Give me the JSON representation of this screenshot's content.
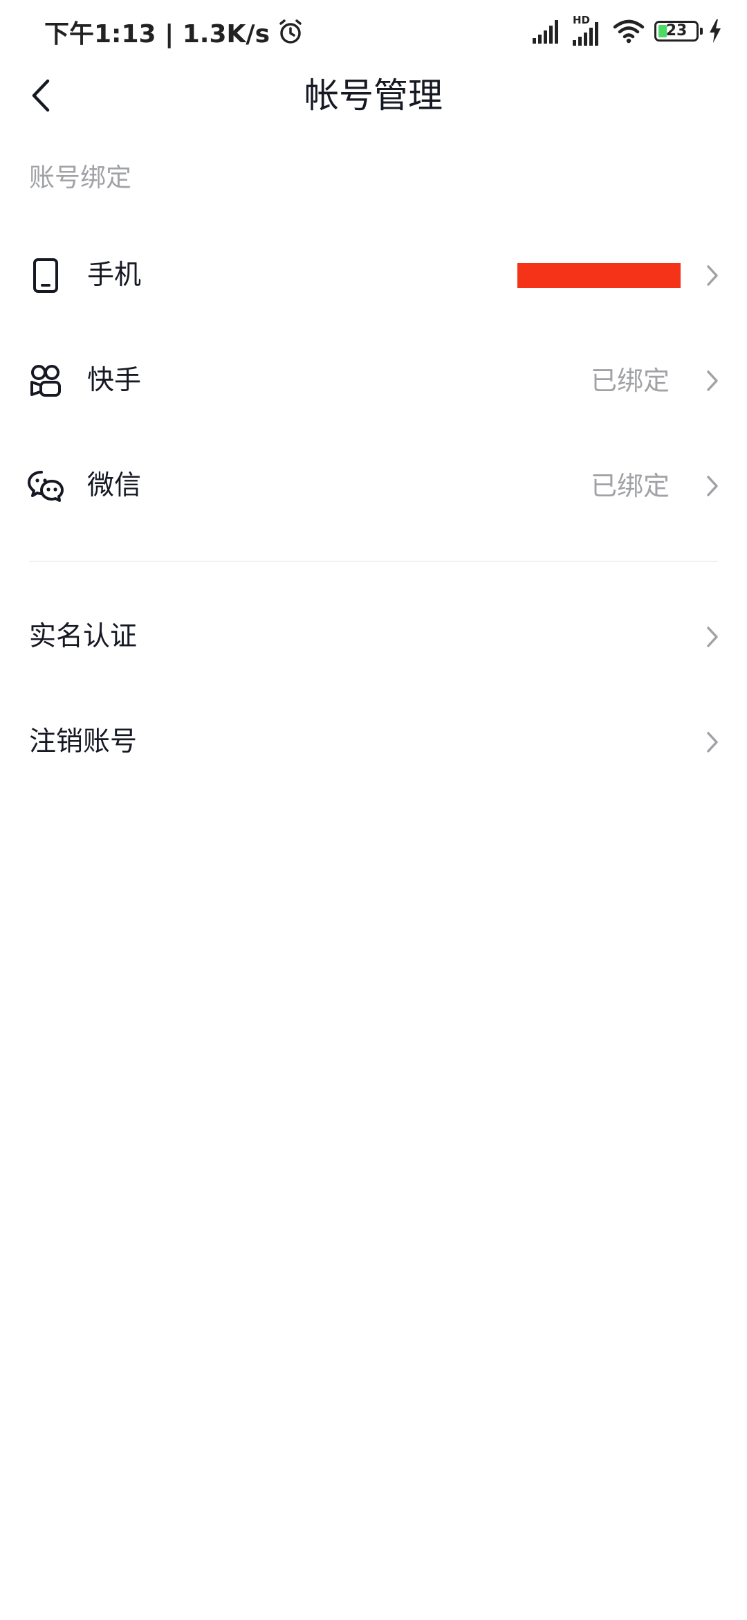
{
  "status_bar": {
    "time_speed": "下午1:13 | 1.3K/s",
    "network_label": "HD",
    "battery_level": "23",
    "battery_color": "#4cd964"
  },
  "nav": {
    "title": "帐号管理",
    "back_icon": "chevron-left-icon"
  },
  "binding_section": {
    "header": "账号绑定",
    "items": [
      {
        "label": "手机",
        "value": "",
        "icon": "phone-icon",
        "value_redacted": true
      },
      {
        "label": "快手",
        "value": "已绑定",
        "icon": "kuaishou-icon"
      },
      {
        "label": "微信",
        "value": "已绑定",
        "icon": "wechat-icon"
      }
    ]
  },
  "other_section": {
    "items": [
      {
        "label": "实名认证"
      },
      {
        "label": "注销账号"
      }
    ]
  },
  "colors": {
    "redaction": "#f53319",
    "secondary_text": "#a1a2a6",
    "primary_text": "#161823",
    "chevron": "#a1a2a6"
  }
}
